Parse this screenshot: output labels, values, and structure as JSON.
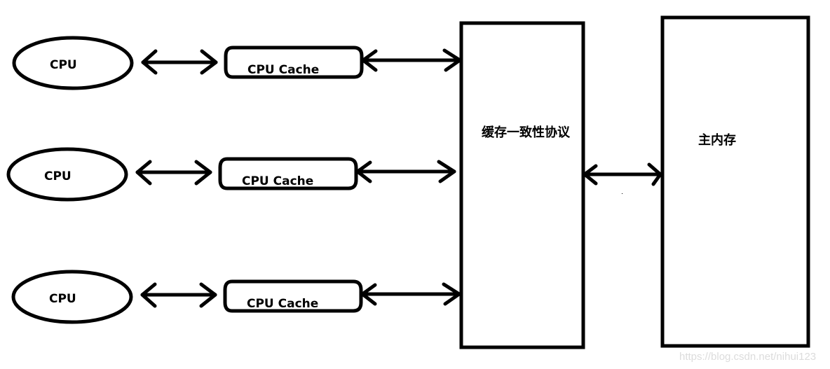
{
  "diagram": {
    "cpus": [
      {
        "label": "CPU"
      },
      {
        "label": "CPU"
      },
      {
        "label": "CPU"
      }
    ],
    "caches": [
      {
        "label": "CPU Cache"
      },
      {
        "label": "CPU Cache"
      },
      {
        "label": "CPU Cache"
      }
    ],
    "coherence_protocol": {
      "label": "缓存一致性协议"
    },
    "main_memory": {
      "label": "主内存"
    },
    "connections": [
      {
        "from": "CPU",
        "to": "CPU Cache",
        "direction": "bidirectional"
      },
      {
        "from": "CPU Cache",
        "to": "缓存一致性协议",
        "direction": "bidirectional"
      },
      {
        "from": "缓存一致性协议",
        "to": "主内存",
        "direction": "bidirectional"
      }
    ]
  },
  "watermark": "https://blog.csdn.net/nihui123",
  "colors": {
    "stroke": "#000000",
    "background": "#ffffff",
    "watermark": "#dcdcdc"
  }
}
